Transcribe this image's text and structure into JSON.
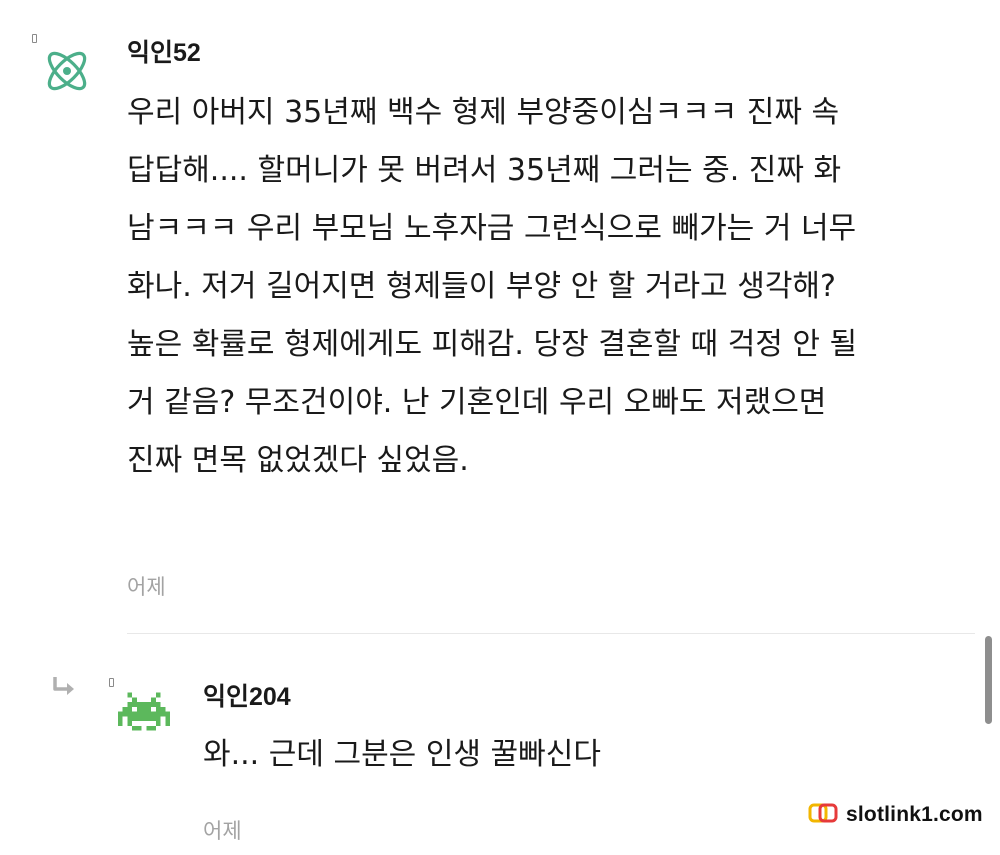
{
  "colors": {
    "avatar_atom": "#4caf8a",
    "avatar_invader": "#5cb85c",
    "timestamp": "#a3a3a3",
    "reply_arrow": "#b0b0b0",
    "watermark_icon_left": "#f2b600",
    "watermark_icon_right": "#e63a3a"
  },
  "comments": [
    {
      "nickname": "익인52",
      "avatar_icon": "atom-icon",
      "lines": [
        "우리 아버지 35년째 백수 형제 부양중이심ㅋㅋㅋ 진짜 속",
        "답답해.... 할머니가 못 버려서 35년째 그러는 중. 진짜 화",
        "남ㅋㅋㅋ 우리 부모님 노후자금 그런식으로 빼가는 거 너무",
        "화나. 저거 길어지면 형제들이 부양 안 할 거라고 생각해?",
        "높은 확률로 형제에게도 피해감. 당장 결혼할 때 걱정 안 될",
        "거 같음? 무조건이야. 난 기혼인데 우리 오빠도 저랬으면",
        "진짜 면목 없었겠다 싶었음."
      ],
      "time": "어제"
    },
    {
      "nickname": "익인204",
      "avatar_icon": "space-invader-icon",
      "is_reply": true,
      "lines": [
        "와... 근데 그분은 인생 꿀빠신다"
      ],
      "time": "어제"
    }
  ],
  "watermark": {
    "text": "slotlink1.com",
    "icon": "double-rounded-square-logo-icon"
  }
}
